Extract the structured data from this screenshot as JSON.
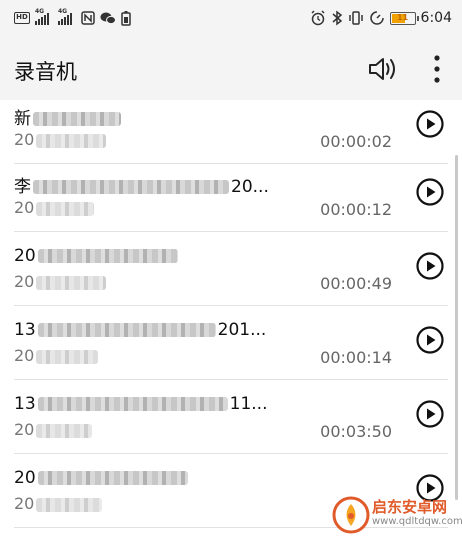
{
  "status_bar": {
    "network_badge": "HD",
    "sim1": "4G",
    "sim2": "4G",
    "battery_level": "11",
    "time": "6:04"
  },
  "app_bar": {
    "title": "录音机",
    "speaker_icon": "speaker-icon",
    "more_icon": "more-vert-icon"
  },
  "recordings": [
    {
      "name_visible": "新",
      "date_visible": "20",
      "duration": "00:00:02"
    },
    {
      "name_visible": "李",
      "name_suffix": "20...",
      "date_visible": "20",
      "duration": "00:00:12"
    },
    {
      "name_visible": "20",
      "date_visible": "20",
      "duration": "00:00:49"
    },
    {
      "name_visible": "13",
      "name_suffix": "201...",
      "date_visible": "20",
      "duration": "00:00:14"
    },
    {
      "name_visible": "13",
      "name_suffix": "11...",
      "date_visible": "20",
      "duration": "00:03:50"
    },
    {
      "name_visible": "20",
      "date_visible": "20",
      "duration": ""
    }
  ],
  "watermark": {
    "text": "启东安卓网",
    "url": "www.qdltdqw.com"
  }
}
